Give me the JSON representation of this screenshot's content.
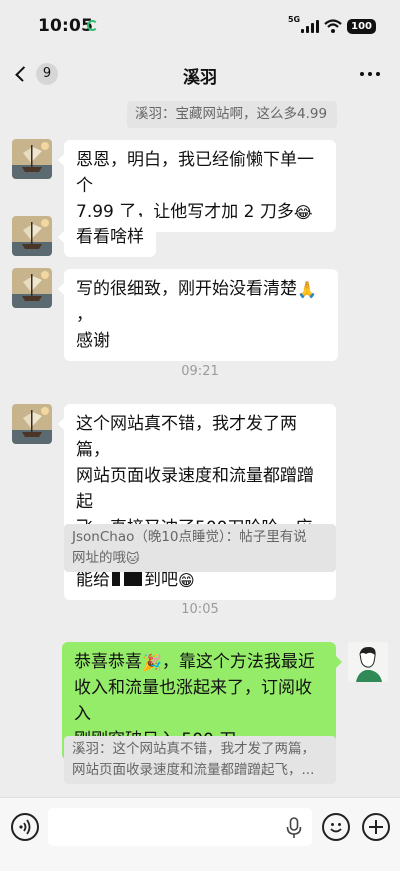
{
  "status_bar": {
    "time": "10:05",
    "network": "5G",
    "battery": "100"
  },
  "nav": {
    "back_count": "9",
    "title": "溪羽"
  },
  "messages": {
    "quote_top": "溪羽：宝藏网站啊，这么多4.99",
    "m1_line1": "恩恩，明白，我已经偷懒下单一个",
    "m1_line2": "7.99 了，让他写才加 2 刀多",
    "m2": "看看啥样",
    "m3_line1": "写的很细致，刚开始没看清楚",
    "m3_line1b": "，",
    "m3_line2": "感谢",
    "time1": "09:21",
    "m4_line1": "这个网站真不错，我才发了两篇，",
    "m4_line2": "网站页面收录速度和流量都蹭蹭起",
    "m4_line3": "飞，直接又冲了500刀哈哈，应该",
    "m4_line4a": "能给",
    "m4_line4b": "到吧",
    "quote1_line1": "JsonChao（晚10点睡觉）：帖子里有说",
    "quote1_line2": "网址的哦",
    "time2": "10:05",
    "m5_line1a": "恭喜恭喜",
    "m5_line1b": "，靠这个方法我最近",
    "m5_line2": "收入和流量也涨起来了，订阅收入",
    "m5_line3": "刚刚突破日入 500 刀～",
    "quote2_line1": "溪羽：这个网站真不错，我才发了两篇，",
    "quote2_line2": "网站页面收录速度和流量都蹭蹭起飞，..."
  },
  "emojis": {
    "laugh": "😂",
    "praying": "🙏",
    "grin": "😁",
    "cat": "🐱",
    "party": "🎉"
  },
  "colors": {
    "background": "#ededed",
    "my_bubble": "#95ec69",
    "other_bubble": "#ffffff",
    "status_ring": "#2fbf71"
  }
}
